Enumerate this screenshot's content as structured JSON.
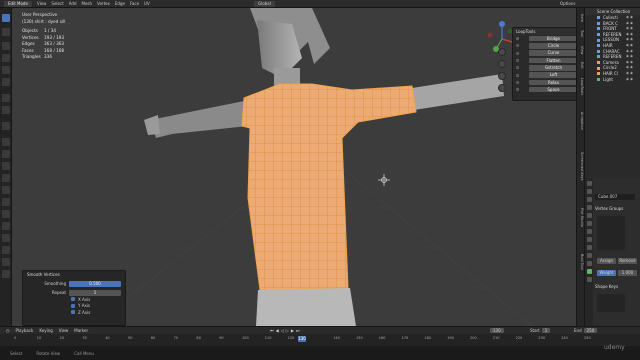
{
  "header": {
    "mode": "Edit Mode",
    "menus": [
      "View",
      "Select",
      "Add",
      "Mesh",
      "Vertex",
      "Edge",
      "Face",
      "UV"
    ],
    "orientation": "Global",
    "options": "Options"
  },
  "viewport_info": {
    "line1": "User Perspective",
    "line2": "(130) shirt : dyed sill",
    "stats": [
      {
        "k": "Objects",
        "v": "1 / 34"
      },
      {
        "k": "Vertices",
        "v": "193 / 193"
      },
      {
        "k": "Edges",
        "v": "363 / 363"
      },
      {
        "k": "Faces",
        "v": "168 / 168"
      },
      {
        "k": "Triangles",
        "v": "336"
      }
    ]
  },
  "looptools": {
    "title": "LoopTools",
    "items": [
      "Bridge",
      "Circle",
      "Curve",
      "Flatten",
      "Gstretch",
      "Loft",
      "Relax",
      "Space"
    ]
  },
  "smooth_panel": {
    "title": "Smooth Vertices",
    "smoothing_label": "Smoothing",
    "smoothing_value": "0.500",
    "repeat_label": "Repeat",
    "repeat_value": "1",
    "axes": [
      "X Axis",
      "Y Axis",
      "Z Axis"
    ]
  },
  "outliner": {
    "title": "Scene Collection",
    "items": [
      "Collecti",
      "BACK C",
      "FRONT",
      "REFEREN",
      "LESSON",
      "HAIR",
      "CHARAC",
      "REFEREN",
      "Camera",
      "Circle2",
      "HAIR CI",
      "Light"
    ]
  },
  "properties": {
    "object_name": "Cube.007",
    "vertex_groups": "Vertex Groups",
    "assign": "Assign",
    "remove": "Remove",
    "weight_label": "Weight",
    "weight_value": "1.000",
    "shape_keys": "Shape Keys"
  },
  "tabs": [
    "Item",
    "Tool",
    "View",
    "Edit",
    "LoopTools",
    "Animation",
    "Screencast Keys",
    "Plot Studio",
    "Bool Tool"
  ],
  "timeline": {
    "menus": [
      "Playback",
      "Keying",
      "View",
      "Marker"
    ],
    "frame": "130",
    "start_label": "Start",
    "start": "1",
    "end_label": "End",
    "end": "250",
    "ticks": [
      "0",
      "10",
      "20",
      "30",
      "40",
      "50",
      "60",
      "70",
      "80",
      "90",
      "100",
      "110",
      "120",
      "130",
      "140",
      "150",
      "160",
      "170",
      "180",
      "190",
      "200",
      "210",
      "220",
      "230",
      "240",
      "250"
    ]
  },
  "status": {
    "items": [
      "Select",
      "Rotate View",
      "Call Menu"
    ]
  },
  "watermark": "udemy",
  "colors": {
    "accent": "#4a74b8",
    "mesh_highlight": "#f0a34a",
    "viewport_bg": "#3c3c3c"
  }
}
